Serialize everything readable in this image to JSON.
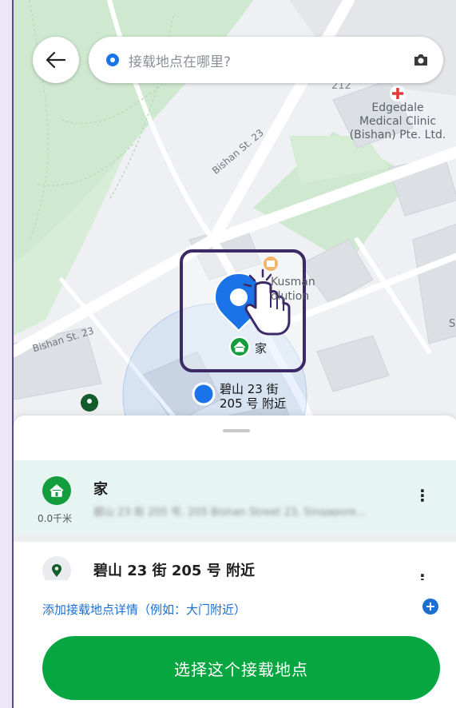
{
  "search": {
    "placeholder": "接载地点在哪里?"
  },
  "map": {
    "street_1": "Bishan St. 23",
    "street_2": "Bishan St. 23",
    "poi_number": "212",
    "clinic_line1": "Edgedale",
    "clinic_line2": "Medical Clinic",
    "clinic_line3": "(Bishan) Pte. Ltd.",
    "shop_name_1": "Kusman",
    "shop_name_2": "olution",
    "home_label": "家",
    "current_line1": "碧山 23 街",
    "current_line2": "205 号 附近",
    "edge_letter": "S"
  },
  "saved_home": {
    "title": "家",
    "distance": "0.0千米",
    "address_blurred": "碧山 23 街 205 号, 205 Bishan Street 23, Singapore..."
  },
  "nearby": {
    "title": "碧山 23 街 205 号 附近"
  },
  "add_details_link": "添加接载地点详情（例如：大门附近）",
  "confirm_button": "选择这个接载地点",
  "colors": {
    "primary_green": "#07a640",
    "link_blue": "#1a6fd1",
    "pin_blue": "#1a73e8"
  }
}
